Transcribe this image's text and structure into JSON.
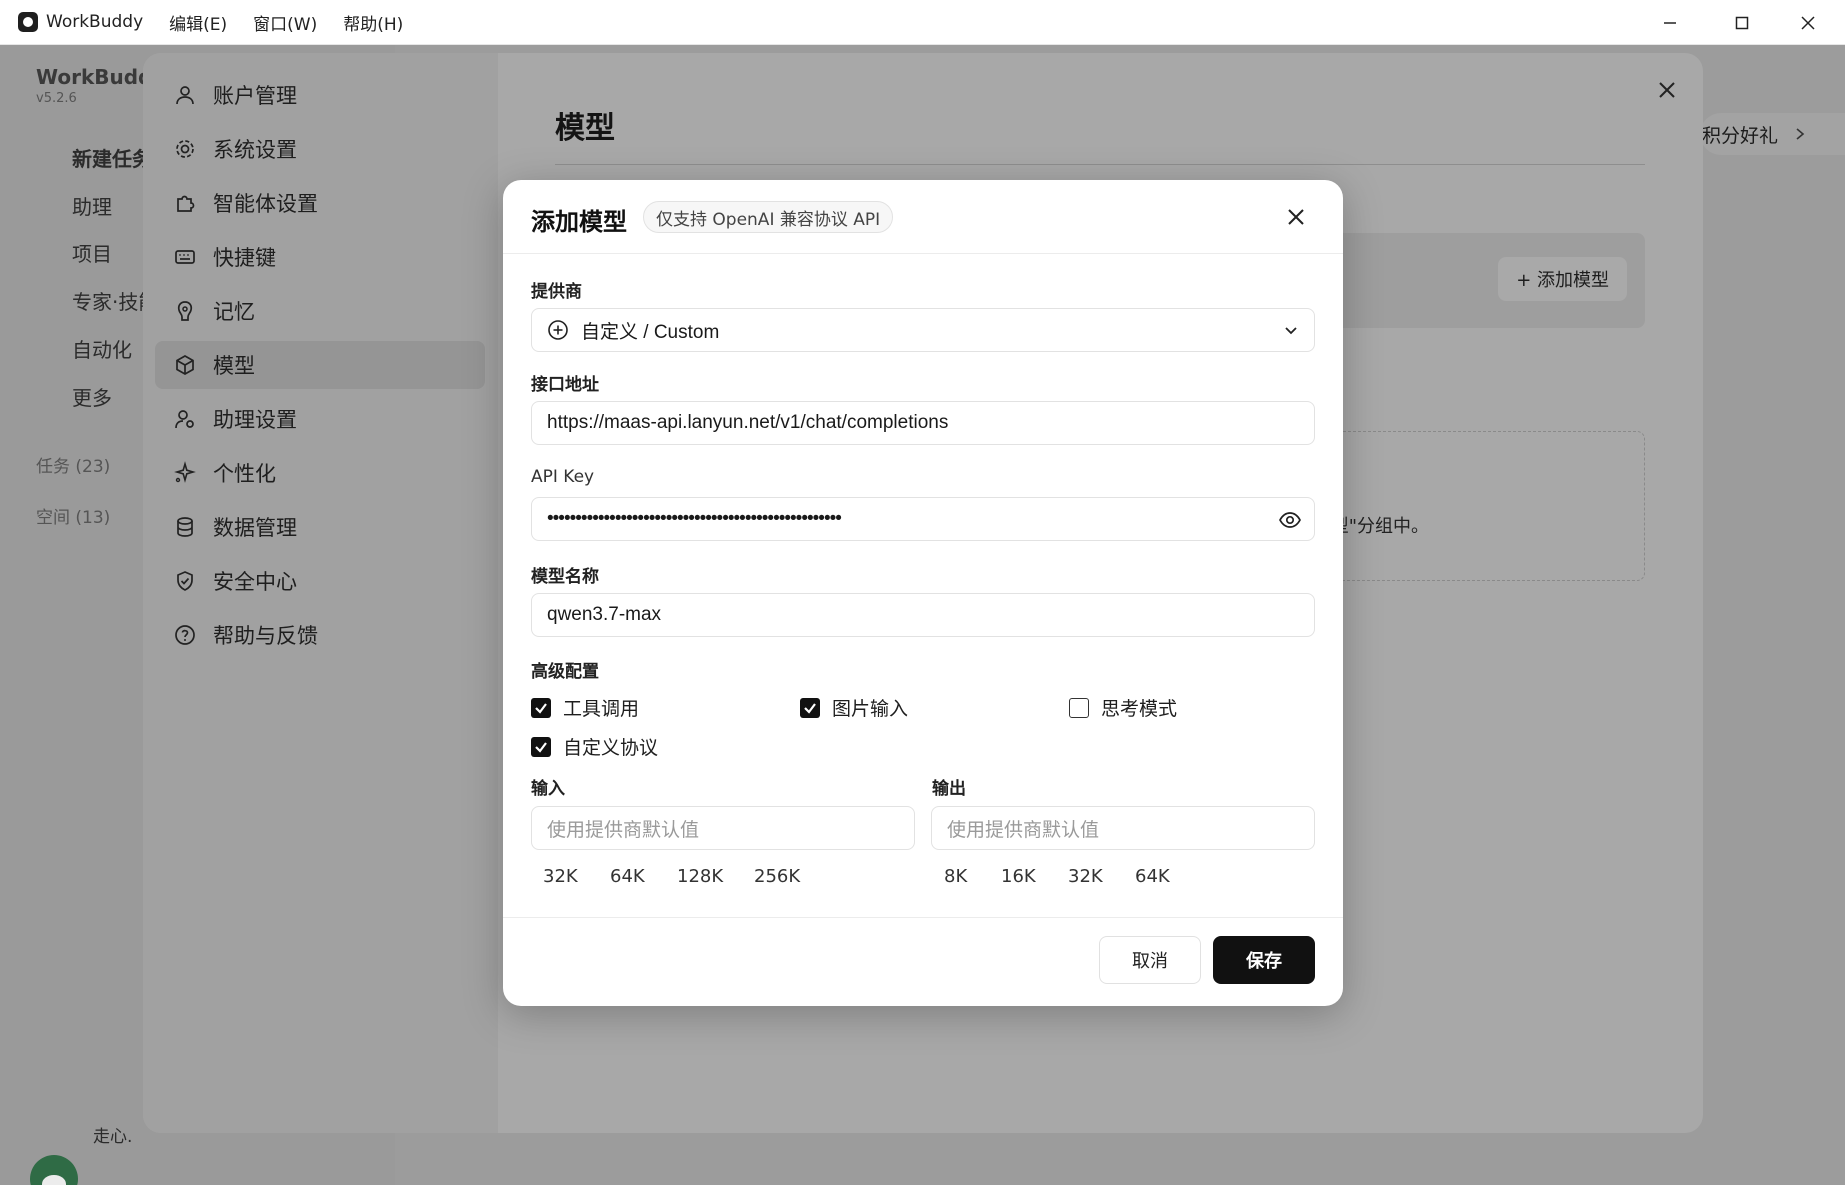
{
  "titlebar": {
    "app_name": "WorkBuddy",
    "menus": [
      "编辑(E)",
      "窗口(W)",
      "帮助(H)"
    ]
  },
  "background": {
    "brand": "WorkBuddy",
    "version": "v5.2.6",
    "sidebar_items": [
      "新建任务",
      "助理",
      "项目",
      "专家·技能",
      "自动化",
      "更多"
    ],
    "sections": [
      "任务 (23)",
      "空间 (13)"
    ],
    "user_name": "走心.",
    "promo": "积分好礼"
  },
  "settings": {
    "nav": [
      {
        "label": "账户管理",
        "icon": "user-icon"
      },
      {
        "label": "系统设置",
        "icon": "gear-icon"
      },
      {
        "label": "智能体设置",
        "icon": "puzzle-icon"
      },
      {
        "label": "快捷键",
        "icon": "keyboard-icon"
      },
      {
        "label": "记忆",
        "icon": "brain-icon"
      },
      {
        "label": "模型",
        "icon": "cube-icon"
      },
      {
        "label": "助理设置",
        "icon": "assistant-icon"
      },
      {
        "label": "个性化",
        "icon": "sparkle-icon"
      },
      {
        "label": "数据管理",
        "icon": "database-icon"
      },
      {
        "label": "安全中心",
        "icon": "shield-icon"
      },
      {
        "label": "帮助与反馈",
        "icon": "help-icon"
      }
    ],
    "active_index": 5,
    "page_title": "模型",
    "add_model_button": "+ 添加模型",
    "hint_text": "型\"分组中。"
  },
  "modal": {
    "title": "添加模型",
    "badge": "仅支持 OpenAI 兼容协议 API",
    "provider_label": "提供商",
    "provider_value": "自定义 / Custom",
    "endpoint_label": "接口地址",
    "endpoint_value": "https://maas-api.lanyun.net/v1/chat/completions",
    "apikey_label": "API Key",
    "apikey_value": "••••••••••••••••••••••••••••••••••••••••••••••••••••",
    "model_name_label": "模型名称",
    "model_name_value": "qwen3.7-max",
    "advanced_label": "高级配置",
    "options": [
      {
        "label": "工具调用",
        "checked": true
      },
      {
        "label": "图片输入",
        "checked": true
      },
      {
        "label": "思考模式",
        "checked": false
      },
      {
        "label": "自定义协议",
        "checked": true
      }
    ],
    "input_label": "输入",
    "output_label": "输出",
    "input_placeholder": "使用提供商默认值",
    "output_placeholder": "使用提供商默认值",
    "input_presets": [
      "32K",
      "64K",
      "128K",
      "256K"
    ],
    "output_presets": [
      "8K",
      "16K",
      "32K",
      "64K"
    ],
    "cancel_label": "取消",
    "save_label": "保存"
  }
}
